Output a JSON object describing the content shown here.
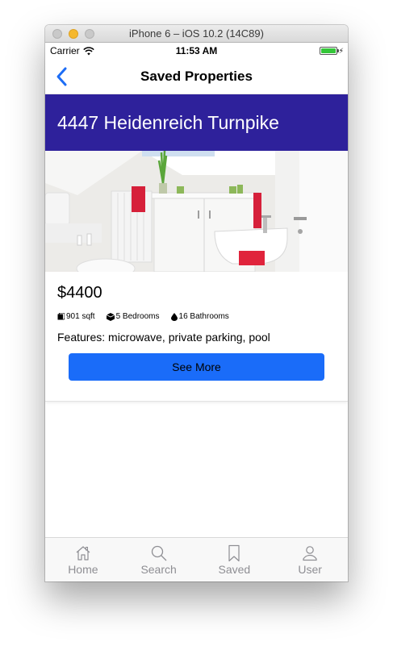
{
  "window": {
    "title": "iPhone 6 – iOS 10.2 (14C89)"
  },
  "status_bar": {
    "carrier": "Carrier",
    "time": "11:53 AM",
    "battery_level": 1.0
  },
  "nav": {
    "title": "Saved Properties",
    "back_icon": "chevron-left-icon"
  },
  "property": {
    "address": "4447 Heidenreich Turnpike",
    "photo": "bathroom-photo",
    "price": "$4400",
    "sqft": "901 sqft",
    "bedrooms": "5 Bedrooms",
    "bathrooms": "16 Bathrooms",
    "features": "Features: microwave, private parking, pool",
    "see_more_label": "See More"
  },
  "tabs": [
    {
      "label": "Home",
      "icon": "house-icon"
    },
    {
      "label": "Search",
      "icon": "magnifier-icon"
    },
    {
      "label": "Saved",
      "icon": "bookmark-icon"
    },
    {
      "label": "User",
      "icon": "person-icon"
    }
  ],
  "colors": {
    "banner": "#2e219b",
    "button": "#1a6cf9",
    "back_arrow": "#1d6df5",
    "tab_inactive": "#8e8e93"
  }
}
